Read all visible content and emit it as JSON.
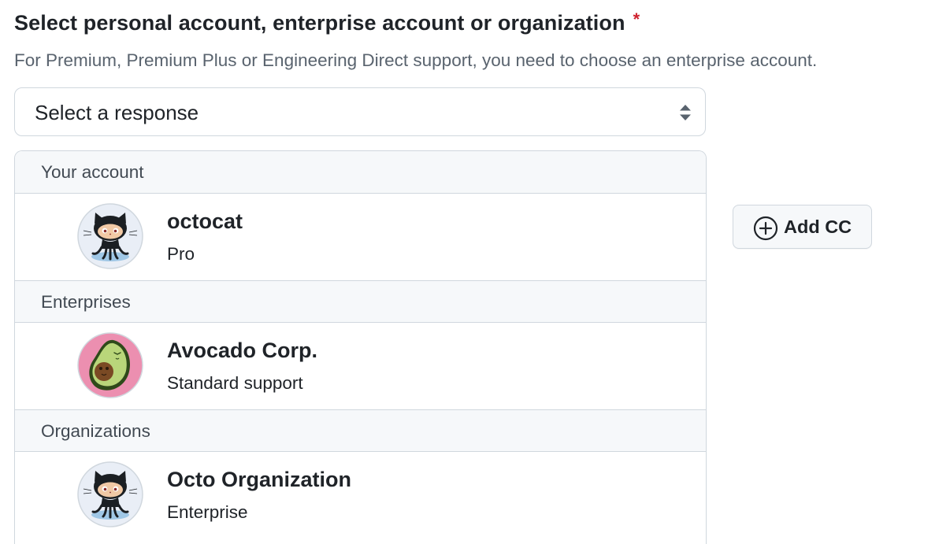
{
  "field": {
    "label": "Select personal account, enterprise account or organization",
    "required_marker": "*",
    "hint": "For Premium, Premium Plus or Engineering Direct support, you need to choose an enterprise account."
  },
  "select": {
    "value": "Select a response",
    "icon": "select-arrows-icon"
  },
  "dropdown": {
    "groups": [
      {
        "header": "Your account",
        "options": [
          {
            "name": "octocat",
            "subtitle": "Pro",
            "avatar": "octocat-avatar"
          }
        ]
      },
      {
        "header": "Enterprises",
        "options": [
          {
            "name": "Avocado Corp.",
            "subtitle": "Standard support",
            "avatar": "avocado-avatar"
          }
        ]
      },
      {
        "header": "Organizations",
        "options": [
          {
            "name": "Octo Organization",
            "subtitle": "Enterprise",
            "avatar": "octocat-avatar"
          }
        ]
      }
    ]
  },
  "cc": {
    "button_label": "Add CC",
    "icon": "plus-circle-icon"
  },
  "colors": {
    "required": "#cf222e",
    "border": "#d0d7de",
    "header_bg": "#f6f8fa",
    "text": "#1f2328",
    "muted": "#59636e"
  }
}
